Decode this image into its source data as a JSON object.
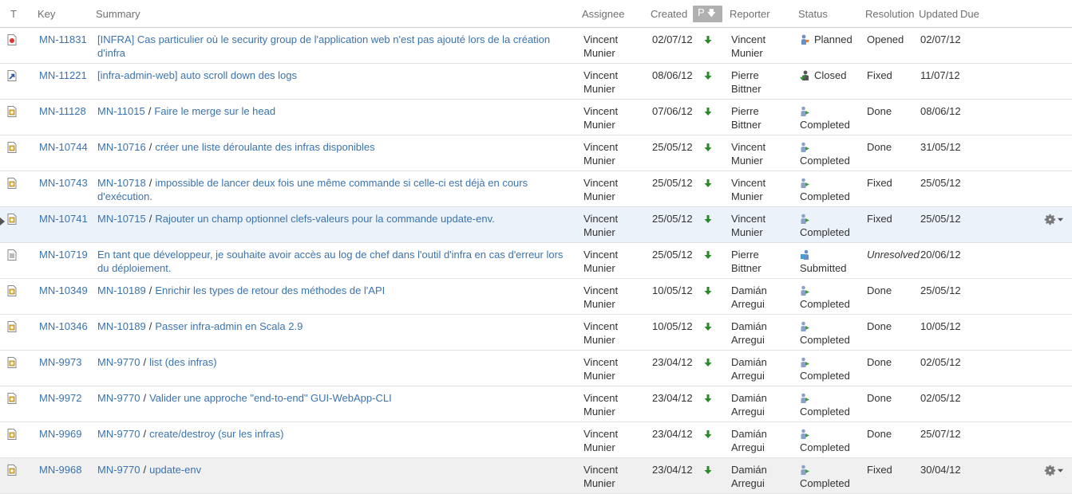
{
  "columns": {
    "type": "T",
    "key": "Key",
    "summary": "Summary",
    "assignee": "Assignee",
    "created": "Created",
    "priority": "P",
    "reporter": "Reporter",
    "status": "Status",
    "resolution": "Resolution",
    "updated": "Updated",
    "due": "Due"
  },
  "colors": {
    "link": "#3b73af",
    "focused_row": "#ebf2f9",
    "priority_arrow": "#2a8a2a"
  },
  "rows": [
    {
      "type": "bug-icon",
      "key": "MN-11831",
      "parent": "",
      "summary": "[INFRA] Cas particulier où le security group de l'application web n'est pas ajouté lors de la création d'infra",
      "assignee": "Vincent Munier",
      "created": "02/07/12",
      "reporter": "Vincent Munier",
      "status": "Planned",
      "status_icon": "planned-icon",
      "resolution": "Opened",
      "updated": "02/07/12",
      "due": ""
    },
    {
      "type": "improvement-icon",
      "key": "MN-11221",
      "parent": "",
      "summary": "[infra-admin-web] auto scroll down des logs",
      "assignee": "Vincent Munier",
      "created": "08/06/12",
      "reporter": "Pierre Bittner",
      "status": "Closed",
      "status_icon": "closed-icon",
      "resolution": "Fixed",
      "updated": "11/07/12",
      "due": ""
    },
    {
      "type": "subtask-icon",
      "key": "MN-11128",
      "parent": "MN-11015",
      "summary": "Faire le merge sur le head",
      "assignee": "Vincent Munier",
      "created": "07/06/12",
      "reporter": "Pierre Bittner",
      "status": "Completed",
      "status_icon": "completed-icon",
      "resolution": "Done",
      "updated": "08/06/12",
      "due": ""
    },
    {
      "type": "subtask-icon",
      "key": "MN-10744",
      "parent": "MN-10716",
      "summary": "créer une liste déroulante des infras disponibles",
      "assignee": "Vincent Munier",
      "created": "25/05/12",
      "reporter": "Vincent Munier",
      "status": "Completed",
      "status_icon": "completed-icon",
      "resolution": "Done",
      "updated": "31/05/12",
      "due": ""
    },
    {
      "type": "subtask-icon",
      "key": "MN-10743",
      "parent": "MN-10718",
      "summary": "impossible de lancer deux fois une même commande si celle-ci est déjà en cours d'exécution.",
      "assignee": "Vincent Munier",
      "created": "25/05/12",
      "reporter": "Vincent Munier",
      "status": "Completed",
      "status_icon": "completed-icon",
      "resolution": "Fixed",
      "updated": "25/05/12",
      "due": ""
    },
    {
      "type": "subtask-icon",
      "key": "MN-10741",
      "parent": "MN-10715",
      "summary": "Rajouter un champ optionnel clefs-valeurs pour la commande update-env.",
      "assignee": "Vincent Munier",
      "created": "25/05/12",
      "reporter": "Vincent Munier",
      "status": "Completed",
      "status_icon": "completed-icon",
      "resolution": "Fixed",
      "updated": "25/05/12",
      "due": "",
      "focused": true
    },
    {
      "type": "story-icon",
      "key": "MN-10719",
      "parent": "",
      "summary": "En tant que développeur, je souhaite avoir accès au log de chef dans l'outil d'infra en cas d'erreur lors du déploiement.",
      "assignee": "Vincent Munier",
      "created": "25/05/12",
      "reporter": "Pierre Bittner",
      "status": "Submitted",
      "status_icon": "submitted-icon",
      "resolution": "Unresolved",
      "updated": "20/06/12",
      "due": ""
    },
    {
      "type": "subtask-icon",
      "key": "MN-10349",
      "parent": "MN-10189",
      "summary": "Enrichir les types de retour des méthodes de l'API",
      "assignee": "Vincent Munier",
      "created": "10/05/12",
      "reporter": "Damián Arregui",
      "status": "Completed",
      "status_icon": "completed-icon",
      "resolution": "Done",
      "updated": "25/05/12",
      "due": ""
    },
    {
      "type": "subtask-icon",
      "key": "MN-10346",
      "parent": "MN-10189",
      "summary": "Passer infra-admin en Scala 2.9",
      "assignee": "Vincent Munier",
      "created": "10/05/12",
      "reporter": "Damián Arregui",
      "status": "Completed",
      "status_icon": "completed-icon",
      "resolution": "Done",
      "updated": "10/05/12",
      "due": ""
    },
    {
      "type": "subtask-icon",
      "key": "MN-9973",
      "parent": "MN-9770",
      "summary": "list (des infras)",
      "assignee": "Vincent Munier",
      "created": "23/04/12",
      "reporter": "Damián Arregui",
      "status": "Completed",
      "status_icon": "completed-icon",
      "resolution": "Done",
      "updated": "02/05/12",
      "due": ""
    },
    {
      "type": "subtask-icon",
      "key": "MN-9972",
      "parent": "MN-9770",
      "summary": "Valider une approche \"end-to-end\" GUI-WebApp-CLI",
      "assignee": "Vincent Munier",
      "created": "23/04/12",
      "reporter": "Damián Arregui",
      "status": "Completed",
      "status_icon": "completed-icon",
      "resolution": "Done",
      "updated": "02/05/12",
      "due": ""
    },
    {
      "type": "subtask-icon",
      "key": "MN-9969",
      "parent": "MN-9770",
      "summary": "create/destroy (sur les infras)",
      "assignee": "Vincent Munier",
      "created": "23/04/12",
      "reporter": "Damián Arregui",
      "status": "Completed",
      "status_icon": "completed-icon",
      "resolution": "Done",
      "updated": "25/07/12",
      "due": ""
    },
    {
      "type": "subtask-icon",
      "key": "MN-9968",
      "parent": "MN-9770",
      "summary": "update-env",
      "assignee": "Vincent Munier",
      "created": "23/04/12",
      "reporter": "Damián Arregui",
      "status": "Completed",
      "status_icon": "completed-icon",
      "resolution": "Fixed",
      "updated": "30/04/12",
      "due": "",
      "hovered": true
    }
  ]
}
